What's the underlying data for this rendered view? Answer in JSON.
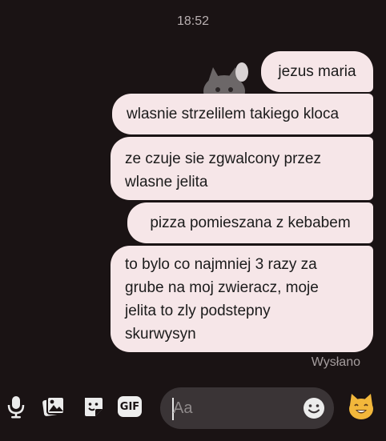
{
  "thread": {
    "timestamp": "18:52",
    "messages": [
      {
        "text": "jezus maria"
      },
      {
        "text": "wlasnie strzelilem takiego kloca"
      },
      {
        "lines": [
          "ze czuje sie zgwalcony przez",
          "wlasne jelita"
        ]
      },
      {
        "text": "pizza pomieszana z kebabem"
      },
      {
        "lines": [
          "to bylo co najmniej 3 razy za",
          "grube na moj zwieracz, moje",
          "jelita to zly podstepny",
          "skurwysyn"
        ]
      }
    ],
    "status": "Wysłano"
  },
  "composer": {
    "placeholder": "Aa",
    "icons": [
      "microphone-icon",
      "gallery-icon",
      "sticker-icon",
      "gif-icon",
      "emoji-icon",
      "cat-emoji-icon"
    ],
    "gif_label": "GIF"
  },
  "colors": {
    "background": "#1a1314",
    "bubble": "#f6e6e8",
    "input": "#3a3436"
  }
}
